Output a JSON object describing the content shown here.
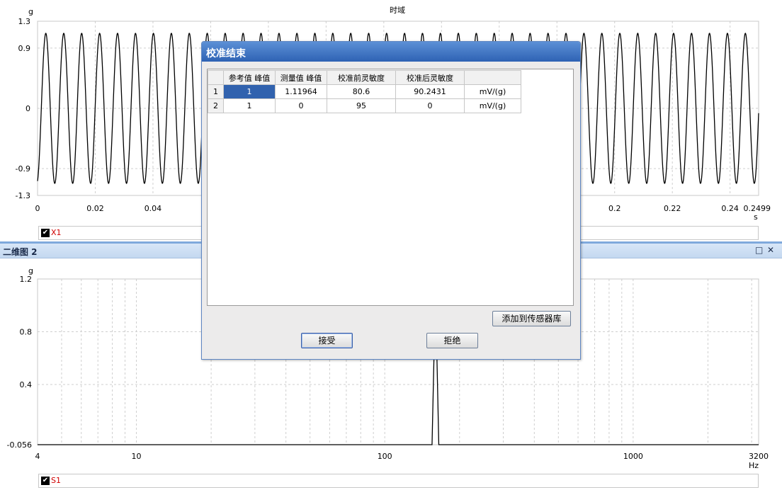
{
  "top_chart": {
    "title": "时域",
    "y_unit": "g",
    "y_ticks": [
      "1.3",
      "0.9",
      "0",
      "-0.9",
      "-1.3"
    ],
    "x_ticks": [
      "0",
      "0.02",
      "0.04",
      "0.2",
      "0.22",
      "0.24",
      "0.2499"
    ],
    "x_unit": "s",
    "legend": "X1",
    "chart_data": {
      "type": "line",
      "series": [
        {
          "name": "X1",
          "signal": "sine",
          "amplitude": 1.12
        }
      ],
      "xlim": [
        0,
        0.2499
      ],
      "ylim": [
        -1.3,
        1.3
      ],
      "grid": true
    }
  },
  "panel": {
    "title": "二维图 2",
    "maximize_icon": "□",
    "close_icon": "✕"
  },
  "bottom_chart": {
    "y_unit": "g",
    "y_ticks": [
      "1.2",
      "0.8",
      "0.4",
      "-0.056"
    ],
    "x_ticks": [
      "4",
      "10",
      "100",
      "1000",
      "3200"
    ],
    "x_unit": "Hz",
    "legend": "S1",
    "chart_data": {
      "type": "line",
      "x_scale": "log",
      "xlim": [
        4,
        3200
      ],
      "ylim": [
        -0.056,
        1.2
      ],
      "series": [
        {
          "name": "S1",
          "x": [
            4,
            155,
            160,
            165,
            3200
          ],
          "y": [
            -0.056,
            -0.056,
            1.12,
            -0.056,
            -0.056
          ]
        }
      ],
      "grid": true
    }
  },
  "dialog": {
    "title": "校准结束",
    "columns": [
      "参考值 峰值",
      "测量值 峰值",
      "校准前灵敏度",
      "校准后灵敏度",
      ""
    ],
    "rows": [
      {
        "index": "1",
        "cells": [
          "1",
          "1.11964",
          "80.6",
          "90.2431",
          "mV/(g)"
        ]
      },
      {
        "index": "2",
        "cells": [
          "1",
          "0",
          "95",
          "0",
          "mV/(g)"
        ]
      }
    ],
    "add_button": "添加到传感器库",
    "accept_button": "接受",
    "reject_button": "拒绝"
  }
}
